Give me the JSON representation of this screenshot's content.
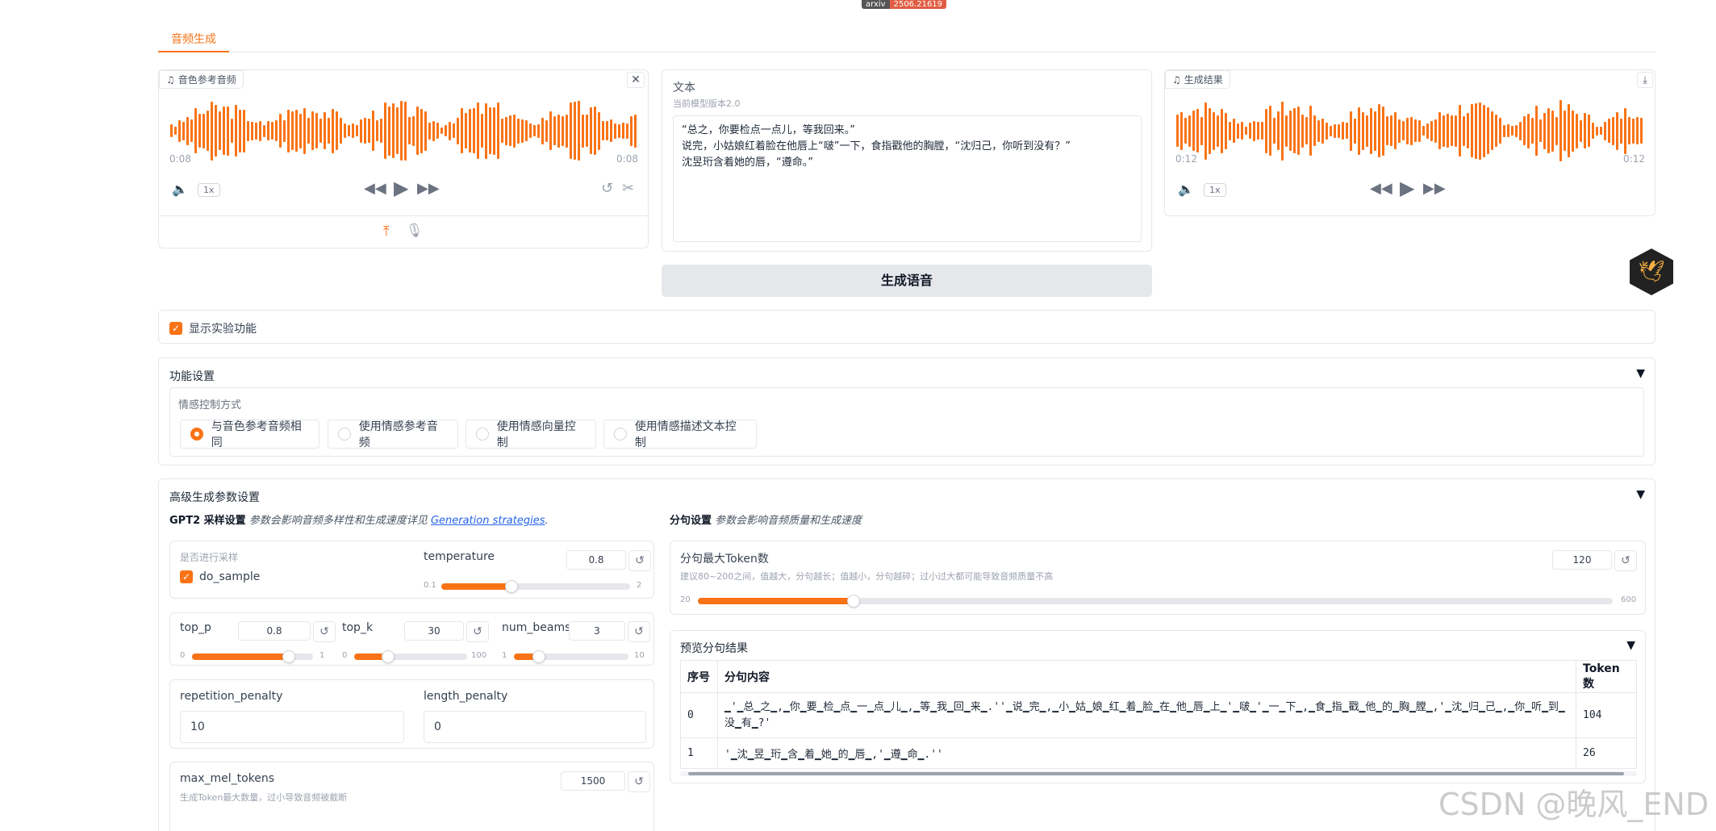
{
  "top_badge": {
    "left": "arxiv",
    "right": "2506.21619"
  },
  "tabs": [
    {
      "label": "音频生成"
    }
  ],
  "ref_audio": {
    "tag": "音色参考音频",
    "time_left": "0:08",
    "time_right": "0:08",
    "speed": "1x"
  },
  "text_box": {
    "label": "文本",
    "sublabel": "当前模型版本2.0",
    "lines": [
      "“总之，你要检点一点儿，等我回来。”",
      "说完，小姑娘红着脸在他唇上“啵”一下，食指戳他的胸膛，“沈归己，你听到没有？”",
      "沈昱珩含着她的唇，“遵命。”"
    ]
  },
  "result_audio": {
    "tag": "生成结果",
    "time_left": "0:12",
    "time_right": "0:12",
    "speed": "1x"
  },
  "generate_button": "生成语音",
  "experimental": {
    "label": "显示实验功能"
  },
  "function_settings": {
    "title": "功能设置",
    "emotion_label": "情感控制方式",
    "options": [
      "与音色参考音频相同",
      "使用情感参考音频",
      "使用情感向量控制",
      "使用情感描述文本控制"
    ],
    "selected": 0
  },
  "advanced": {
    "title": "高级生成参数设置",
    "gpt2_title": "GPT2 采样设置",
    "gpt2_desc": "参数会影响音频多样性和生成速度详见",
    "gpt2_link": "Generation strategies",
    "gpt2_link_suffix": ".",
    "sampling_label": "是否进行采样",
    "do_sample": "do_sample",
    "temperature": {
      "label": "temperature",
      "value": "0.8",
      "min": "0.1",
      "max": "2",
      "fraction": 0.37
    },
    "top_p": {
      "label": "top_p",
      "value": "0.8",
      "min": "0",
      "max": "1",
      "fraction": 0.8
    },
    "top_k": {
      "label": "top_k",
      "value": "30",
      "min": "0",
      "max": "100",
      "fraction": 0.3
    },
    "num_beams": {
      "label": "num_beams",
      "value": "3",
      "min": "1",
      "max": "10",
      "fraction": 0.22
    },
    "repetition_penalty": {
      "label": "repetition_penalty",
      "value": "10"
    },
    "length_penalty": {
      "label": "length_penalty",
      "value": "0"
    },
    "max_mel_tokens": {
      "label": "max_mel_tokens",
      "value": "1500",
      "hint": "生成Token最大数量，过小导致音频被截断"
    },
    "split_title": "分句设置",
    "split_desc": "参数会影响音频质量和生成速度",
    "split_max": {
      "label": "分句最大Token数",
      "hint": "建议80~200之间，值越大，分句越长；值越小，分句越碎；过小过大都可能导致音频质量不高",
      "value": "120",
      "min": "20",
      "max": "600",
      "fraction": 0.17
    },
    "preview": {
      "title": "预览分句结果",
      "headers": [
        "序号",
        "分句内容",
        "Token数"
      ],
      "rows": [
        [
          "0",
          "▁'▁总▁之▁,▁你▁要▁检▁点▁一▁点▁儿▁,▁等▁我▁回▁来▁.''▁说▁完▁,▁小▁姑▁娘▁红▁着▁脸▁在▁他▁唇▁上▁'▁啵▁'▁一▁下▁,▁食▁指▁戳▁他▁的▁胸▁膛▁,'▁沈▁归▁己▁,▁你▁听▁到▁没▁有▁?'",
          "104"
        ],
        [
          "1",
          "'▁沈▁昱▁珩▁含▁着▁她▁的▁唇▁,'▁遵▁命▁.''",
          "26"
        ]
      ]
    }
  },
  "watermark": "CSDN @晚风_END",
  "colors": {
    "accent": "#f97316",
    "border": "#e5e7eb"
  }
}
